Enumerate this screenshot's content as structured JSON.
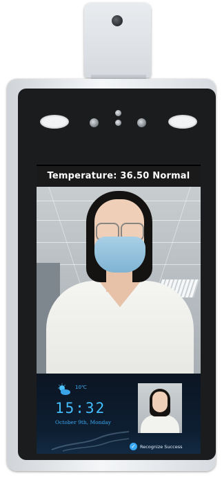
{
  "screen": {
    "temperature_label": "Temperature: 36.50  Normal"
  },
  "widget": {
    "weather_icon": "cloud-sun-icon",
    "weather_temp": "10℃",
    "time": "15:32",
    "date": "October 9th, Monday"
  },
  "recognition": {
    "status_icon": "check-circle-icon",
    "status_text": "Recognize Success"
  },
  "colors": {
    "accent_blue": "#43bfff",
    "screen_bg": "#000000"
  }
}
